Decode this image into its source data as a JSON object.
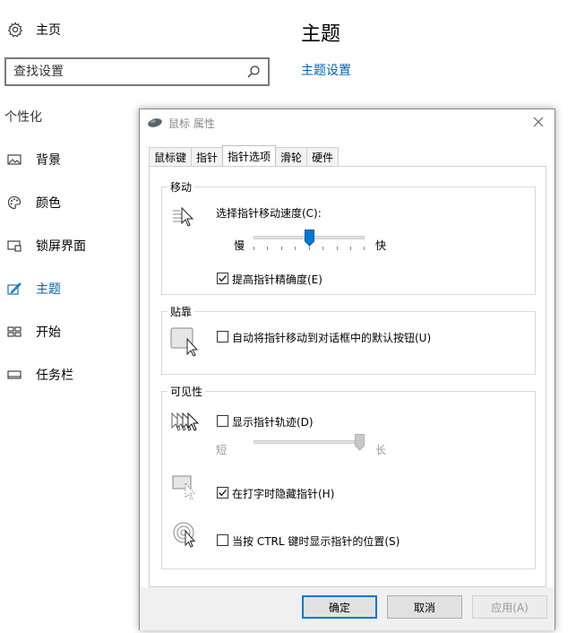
{
  "settings": {
    "home_label": "主页",
    "search_placeholder": "查找设置",
    "section_title": "个性化",
    "nav": [
      {
        "label": "背景",
        "icon": "image-icon"
      },
      {
        "label": "颜色",
        "icon": "palette-icon"
      },
      {
        "label": "锁屏界面",
        "icon": "lock-screen-icon"
      },
      {
        "label": "主题",
        "icon": "theme-icon",
        "active": true
      },
      {
        "label": "开始",
        "icon": "start-icon"
      },
      {
        "label": "任务栏",
        "icon": "taskbar-icon"
      }
    ],
    "page_title": "主题",
    "theme_settings_link": "主题设置",
    "accent_color": "#0063b1"
  },
  "dialog": {
    "title": "鼠标 属性",
    "tabs": [
      "鼠标键",
      "指针",
      "指针选项",
      "滑轮",
      "硬件"
    ],
    "active_tab": 2,
    "motion": {
      "group_title": "移动",
      "speed_label": "选择指针移动速度(C):",
      "slow_label": "慢",
      "fast_label": "快",
      "speed_value_fraction": 0.5,
      "precision_label": "提高指针精确度(E)",
      "precision_checked": true
    },
    "snap": {
      "group_title": "贴靠",
      "snap_label": "自动将指针移动到对话框中的默认按钮(U)",
      "snap_checked": false
    },
    "visibility": {
      "group_title": "可见性",
      "trails_label": "显示指针轨迹(D)",
      "trails_checked": false,
      "short_label": "短",
      "long_label": "长",
      "trails_value_fraction": 1.0,
      "hide_label": "在打字时隐藏指针(H)",
      "hide_checked": true,
      "ctrl_label": "当按 CTRL 键时显示指针的位置(S)",
      "ctrl_checked": false
    },
    "buttons": {
      "ok": "确定",
      "cancel": "取消",
      "apply": "应用(A)"
    }
  }
}
